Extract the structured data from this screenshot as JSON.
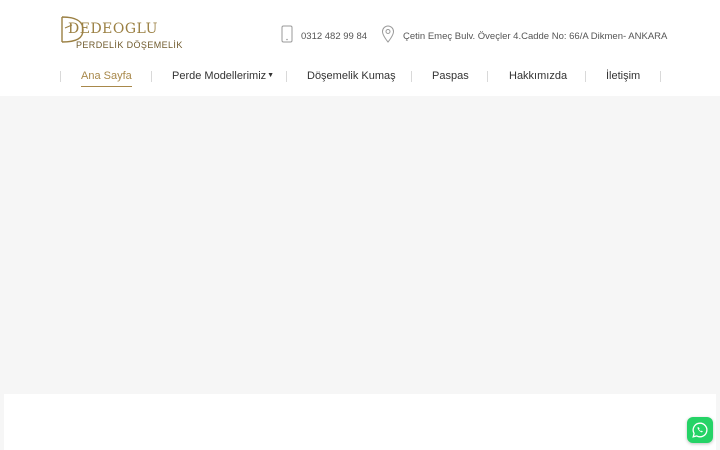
{
  "brand": {
    "name": "DEDEOGLU",
    "tagline": "PERDELİK DÖŞEMELİK"
  },
  "contact": {
    "phone": "0312 482 99 84",
    "phone_icon": "mobile-phone-icon",
    "address": "Çetin Emeç Bulv. Öveçler 4.Cadde No: 66/A Dikmen- ANKARA",
    "address_icon": "map-pin-icon"
  },
  "nav": {
    "items": [
      {
        "label": "Ana Sayfa",
        "active": true
      },
      {
        "label": "Perde Modellerimiz",
        "has_dropdown": true
      },
      {
        "label": "Döşemelik Kumaş"
      },
      {
        "label": "Paspas"
      },
      {
        "label": "Hakkımızda"
      },
      {
        "label": "İletişim"
      }
    ]
  },
  "floating": {
    "whatsapp_icon": "whatsapp-icon"
  },
  "colors": {
    "accent": "#a8884a",
    "hero_background": "#f6f6f6",
    "whatsapp": "#25d366"
  }
}
